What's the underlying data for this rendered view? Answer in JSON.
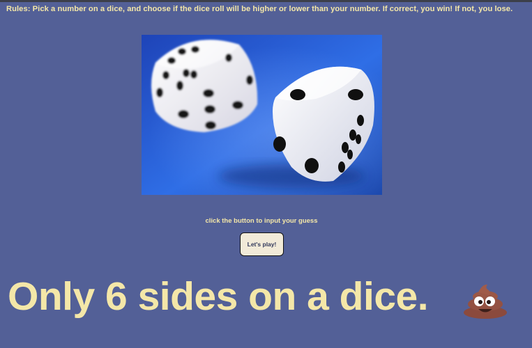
{
  "rules": {
    "text": "Rules: Pick a number on a dice, and choose if the dice roll will be higher or lower than your number. If correct, you win! If not, you lose."
  },
  "game": {
    "prompt": "click the button to input your guess",
    "play_button": "Let's play!"
  },
  "headline": {
    "text": "Only 6 sides on a dice."
  },
  "decor": {
    "emoji": "pile-of-poo-icon"
  },
  "colors": {
    "background": "#536097",
    "text_accent": "#f4e7a8",
    "button_background": "#f1ead8"
  }
}
